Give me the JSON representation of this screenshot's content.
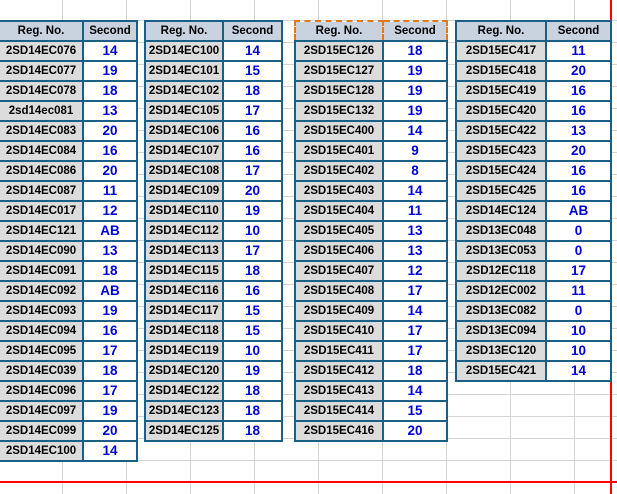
{
  "headers": {
    "reg": "Reg. No.",
    "second": "Second"
  },
  "colors": {
    "header_bg": "#c9d2df",
    "reg_bg": "#dcdcdc",
    "mark_text": "#0000d8",
    "border": "#1b5e86",
    "selection": "#e07a1a"
  },
  "blocks": [
    {
      "rows": [
        {
          "reg": "2SD14EC076",
          "mark": "14"
        },
        {
          "reg": "2SD14EC077",
          "mark": "19"
        },
        {
          "reg": "2SD14EC078",
          "mark": "18"
        },
        {
          "reg": "2sd14ec081",
          "mark": "13"
        },
        {
          "reg": "2SD14EC083",
          "mark": "20"
        },
        {
          "reg": "2SD14EC084",
          "mark": "16"
        },
        {
          "reg": "2SD14EC086",
          "mark": "20"
        },
        {
          "reg": "2SD14EC087",
          "mark": "11"
        },
        {
          "reg": "2SD14EC017",
          "mark": "12"
        },
        {
          "reg": "2SD14EC121",
          "mark": "AB"
        },
        {
          "reg": "2SD14EC090",
          "mark": "13"
        },
        {
          "reg": "2SD14EC091",
          "mark": "18"
        },
        {
          "reg": "2SD14EC092",
          "mark": "AB"
        },
        {
          "reg": "2SD14EC093",
          "mark": "19"
        },
        {
          "reg": "2SD14EC094",
          "mark": "16"
        },
        {
          "reg": "2SD14EC095",
          "mark": "17"
        },
        {
          "reg": "2SD14EC039",
          "mark": "18"
        },
        {
          "reg": "2SD14EC096",
          "mark": "17"
        },
        {
          "reg": "2SD14EC097",
          "mark": "19"
        },
        {
          "reg": "2SD14EC099",
          "mark": "20"
        },
        {
          "reg": "2SD14EC100",
          "mark": "14"
        }
      ]
    },
    {
      "rows": [
        {
          "reg": "2SD14EC100",
          "mark": "14"
        },
        {
          "reg": "2SD14EC101",
          "mark": "15"
        },
        {
          "reg": "2SD14EC102",
          "mark": "18"
        },
        {
          "reg": "2SD14EC105",
          "mark": "17"
        },
        {
          "reg": "2SD14EC106",
          "mark": "16"
        },
        {
          "reg": "2SD14EC107",
          "mark": "16"
        },
        {
          "reg": "2SD14EC108",
          "mark": "17"
        },
        {
          "reg": "2SD14EC109",
          "mark": "20"
        },
        {
          "reg": "2SD14EC110",
          "mark": "19"
        },
        {
          "reg": "2SD14EC112",
          "mark": "10"
        },
        {
          "reg": "2SD14EC113",
          "mark": "17"
        },
        {
          "reg": "2SD14EC115",
          "mark": "18"
        },
        {
          "reg": "2SD14EC116",
          "mark": "16"
        },
        {
          "reg": "2SD14EC117",
          "mark": "15"
        },
        {
          "reg": "2SD14EC118",
          "mark": "15"
        },
        {
          "reg": "2SD14EC119",
          "mark": "10"
        },
        {
          "reg": "2SD14EC120",
          "mark": "19"
        },
        {
          "reg": "2SD14EC122",
          "mark": "18"
        },
        {
          "reg": "2SD14EC123",
          "mark": "18"
        },
        {
          "reg": "2SD14EC125",
          "mark": "18"
        }
      ]
    },
    {
      "rows": [
        {
          "reg": "2SD15EC126",
          "mark": "18"
        },
        {
          "reg": "2SD15EC127",
          "mark": "19"
        },
        {
          "reg": "2SD15EC128",
          "mark": "19"
        },
        {
          "reg": "2SD15EC132",
          "mark": "19"
        },
        {
          "reg": "2SD15EC400",
          "mark": "14"
        },
        {
          "reg": "2SD15EC401",
          "mark": "9"
        },
        {
          "reg": "2SD15EC402",
          "mark": "8"
        },
        {
          "reg": "2SD15EC403",
          "mark": "14"
        },
        {
          "reg": "2SD15EC404",
          "mark": "11"
        },
        {
          "reg": "2SD15EC405",
          "mark": "13"
        },
        {
          "reg": "2SD15EC406",
          "mark": "13"
        },
        {
          "reg": "2SD15EC407",
          "mark": "12"
        },
        {
          "reg": "2SD15EC408",
          "mark": "17"
        },
        {
          "reg": "2SD15EC409",
          "mark": "14"
        },
        {
          "reg": "2SD15EC410",
          "mark": "17"
        },
        {
          "reg": "2SD15EC411",
          "mark": "17"
        },
        {
          "reg": "2SD15EC412",
          "mark": "18"
        },
        {
          "reg": "2SD15EC413",
          "mark": "14"
        },
        {
          "reg": "2SD15EC414",
          "mark": "15"
        },
        {
          "reg": "2SD15EC416",
          "mark": "20"
        }
      ]
    },
    {
      "rows": [
        {
          "reg": "2SD15EC417",
          "mark": "11"
        },
        {
          "reg": "2SD15EC418",
          "mark": "20"
        },
        {
          "reg": "2SD15EC419",
          "mark": "16"
        },
        {
          "reg": "2SD15EC420",
          "mark": "16"
        },
        {
          "reg": "2SD15EC422",
          "mark": "13"
        },
        {
          "reg": "2SD15EC423",
          "mark": "20"
        },
        {
          "reg": "2SD15EC424",
          "mark": "16"
        },
        {
          "reg": "2SD15EC425",
          "mark": "16"
        },
        {
          "reg": "2SD14EC124",
          "mark": "AB"
        },
        {
          "reg": "2SD13EC048",
          "mark": "0"
        },
        {
          "reg": "2SD13EC053",
          "mark": "0"
        },
        {
          "reg": "2SD12EC118",
          "mark": "17"
        },
        {
          "reg": "2SD12EC002",
          "mark": "11"
        },
        {
          "reg": "2SD13EC082",
          "mark": "0"
        },
        {
          "reg": "2SD13EC094",
          "mark": "10"
        },
        {
          "reg": "2SD13EC120",
          "mark": "10"
        },
        {
          "reg": "2SD15EC421",
          "mark": "14"
        }
      ]
    }
  ]
}
